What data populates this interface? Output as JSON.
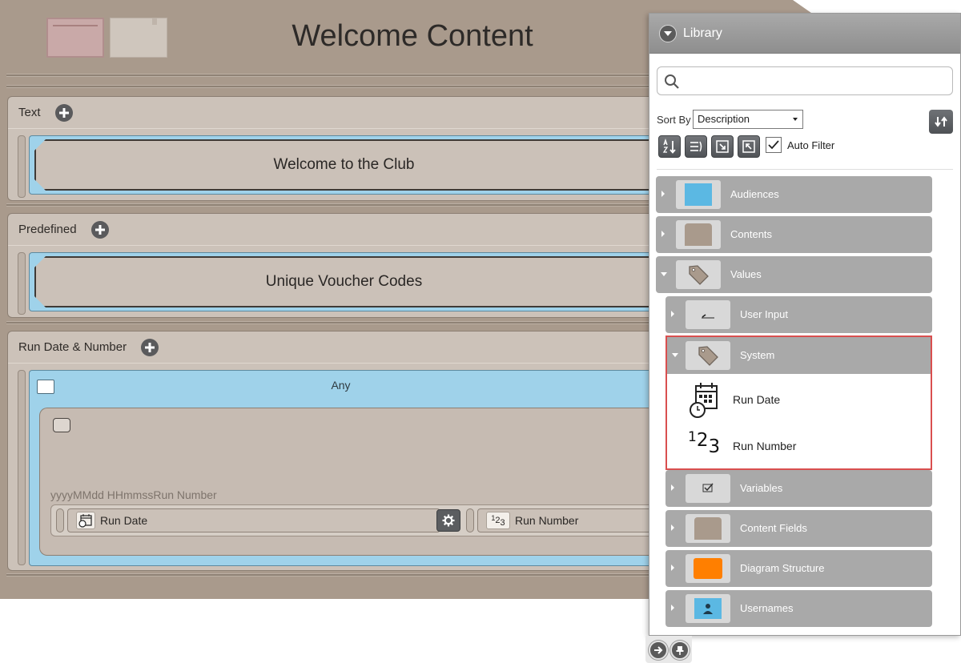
{
  "editor": {
    "title": "Welcome Content",
    "sections": [
      {
        "label": "Text",
        "content": "Welcome to the Club"
      },
      {
        "label": "Predefined",
        "content": "Unique Voucher Codes"
      },
      {
        "label": "Run Date & Number",
        "condition_label": "Any",
        "format_text": "yyyyMMdd HHmmssRun Number",
        "tokens": [
          "Run Date",
          "Run Number"
        ]
      }
    ]
  },
  "library": {
    "title": "Library",
    "search": {
      "value": "",
      "placeholder": ""
    },
    "sort_label": "Sort By",
    "sort_value": "Description",
    "auto_filter_label": "Auto Filter",
    "auto_filter_checked": true,
    "tree": [
      {
        "label": "Audiences",
        "thumb": "blue-square",
        "thumb_color": "#5bb8e3",
        "expanded": false
      },
      {
        "label": "Contents",
        "thumb": "content-tile",
        "thumb_color": "#a99a8c",
        "expanded": false
      },
      {
        "label": "Values",
        "thumb": "tag-icon",
        "expanded": true
      },
      {
        "label": "User Input",
        "thumb": "pen-icon",
        "expanded": false
      },
      {
        "label": "System",
        "thumb": "tag-icon",
        "expanded": true
      },
      {
        "label": "Variables",
        "thumb": "checklist-icon",
        "expanded": false
      },
      {
        "label": "Content Fields",
        "thumb": "content-tile",
        "thumb_color": "#a99a8c",
        "expanded": false
      },
      {
        "label": "Diagram Structure",
        "thumb": "orange-square",
        "thumb_color": "#ff7f00",
        "expanded": false
      },
      {
        "label": "Usernames",
        "thumb": "user-icon",
        "thumb_color": "#5bb8e3",
        "expanded": false
      }
    ],
    "system_children": [
      {
        "label": "Run Date",
        "icon": "calendar-clock-icon"
      },
      {
        "label": "Run Number",
        "icon": "numbers-icon",
        "icon_text": [
          "1",
          "2",
          "3"
        ]
      }
    ],
    "highlight_color": "#d94f4f"
  }
}
